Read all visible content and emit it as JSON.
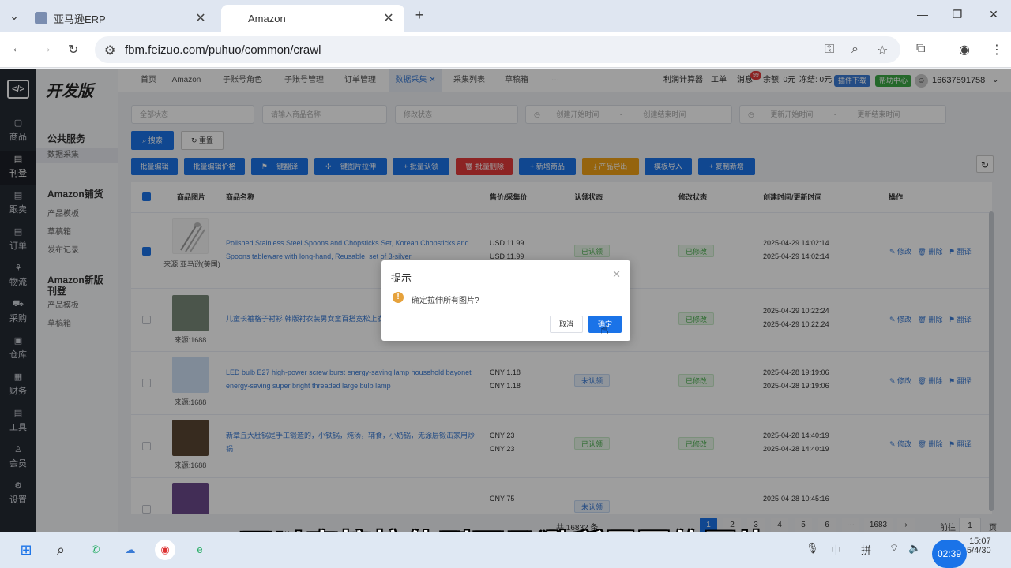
{
  "browser": {
    "tabs": [
      {
        "label": "亚马逊ERP"
      },
      {
        "label": "Amazon"
      }
    ],
    "url": "fbm.feizuo.com/puhuo/common/crawl"
  },
  "sidebar": {
    "items": [
      {
        "label": "商品"
      },
      {
        "label": "刊登"
      },
      {
        "label": "跟卖"
      },
      {
        "label": "订单"
      },
      {
        "label": "物流"
      },
      {
        "label": "采购"
      },
      {
        "label": "仓库"
      },
      {
        "label": "财务"
      },
      {
        "label": "工具"
      },
      {
        "label": "会员"
      },
      {
        "label": "设置"
      }
    ]
  },
  "subnav": {
    "brand": "开发版",
    "groups": [
      {
        "title": "公共服务",
        "items": [
          "数据采集"
        ]
      },
      {
        "title": "Amazon铺货",
        "items": [
          "产品模板",
          "草稿箱",
          "发布记录"
        ]
      },
      {
        "title": "Amazon新版",
        "title2": "刊登",
        "items": [
          "产品模板",
          "草稿箱"
        ]
      }
    ]
  },
  "topnav": {
    "tabs": [
      "首页",
      "Amazon",
      "子账号角色",
      "子账号管理",
      "订单管理",
      "数据采集",
      "采集列表",
      "草稿箱",
      "···"
    ],
    "right": {
      "calc": "利润计算器",
      "ticket": "工单",
      "msg": "消息",
      "msg_count": "99",
      "balance": "余额: 0元",
      "frozen": "冻结: 0元",
      "plugin": "插件下载",
      "help": "帮助中心",
      "phone": "16637591758"
    }
  },
  "filters": {
    "status": "全部状态",
    "name": "请输入商品名称",
    "modify": "修改状态",
    "create_start": "创建开始时间",
    "create_end": "创建结束时间",
    "update_start": "更新开始时间",
    "update_end": "更新结束时间",
    "dash": "-"
  },
  "actions": {
    "search": "搜索",
    "reset": "重置",
    "batch_edit": "批量编辑",
    "batch_price": "批量编辑价格",
    "translate": "一键翻译",
    "stretch": "一键图片拉伸",
    "batch_claim": "批量认领",
    "batch_delete": "批量删除",
    "add": "新增商品",
    "export": "产品导出",
    "import": "模板导入",
    "copy_add": "复制新增"
  },
  "table": {
    "headers": [
      "商品图片",
      "商品名称",
      "售价/采集价",
      "认领状态",
      "修改状态",
      "创建时间/更新时间",
      "操作"
    ],
    "ops": [
      "修改",
      "删除",
      "翻译"
    ],
    "rows": [
      {
        "source": "来源:亚马逊(美国)",
        "name": "Polished Stainless Steel Spoons and Chopsticks Set, Korean Chopsticks and Spoons tableware with long-hand, Reusable, set of 3-silver",
        "price1": "USD 11.99",
        "price2": "USD 11.99",
        "claim": "已认领",
        "modify": "已修改",
        "t1": "2025-04-29 14:02:14",
        "t2": "2025-04-29 14:02:14",
        "checked": true
      },
      {
        "source": "来源:1688",
        "name": "儿童长袖格子衬衫 韩版衬衣装男女童百搭宽松上衣",
        "price1": "",
        "price2": "",
        "claim": "",
        "modify": "已修改",
        "t1": "2025-04-29 10:22:24",
        "t2": "2025-04-29 10:22:24",
        "checked": false
      },
      {
        "source": "来源:1688",
        "name": "LED bulb E27 high-power screw burst energy-saving lamp household bayonet energy-saving super bright threaded large bulb lamp",
        "price1": "CNY 1.18",
        "price2": "CNY 1.18",
        "claim": "未认领",
        "modify": "已修改",
        "t1": "2025-04-28 19:19:06",
        "t2": "2025-04-28 19:19:06",
        "checked": false
      },
      {
        "source": "来源:1688",
        "name": "新章丘大肚锅是手工锻造的，小铁锅，炖汤，辅食，小奶锅，无涂层锻击家用炒锅",
        "price1": "CNY 23",
        "price2": "CNY 23",
        "claim": "已认领",
        "modify": "已修改",
        "t1": "2025-04-28 14:40:19",
        "t2": "2025-04-28 14:40:19",
        "checked": false
      },
      {
        "source": "",
        "name": "",
        "price1": "CNY 75",
        "price2": "",
        "claim": "未认领",
        "modify": "",
        "t1": "2025-04-28 10:45:16",
        "t2": "",
        "checked": false
      }
    ]
  },
  "pagination": {
    "total": "共 16832 条",
    "pages": [
      "1",
      "2",
      "3",
      "4",
      "5",
      "6",
      "···",
      "1683"
    ],
    "current": "1",
    "goto": "前往",
    "goto_val": "1",
    "page_unit": "页"
  },
  "modal": {
    "title": "提示",
    "message": "确定拉伸所有图片?",
    "cancel": "取消",
    "ok": "确定"
  },
  "caption": "可以直接拉伸到亚马逊所需要的图片",
  "taskbar": {
    "ime1": "中",
    "ime2": "拼",
    "time": "15:07",
    "date": "5/4/30",
    "rec": "02:39"
  }
}
